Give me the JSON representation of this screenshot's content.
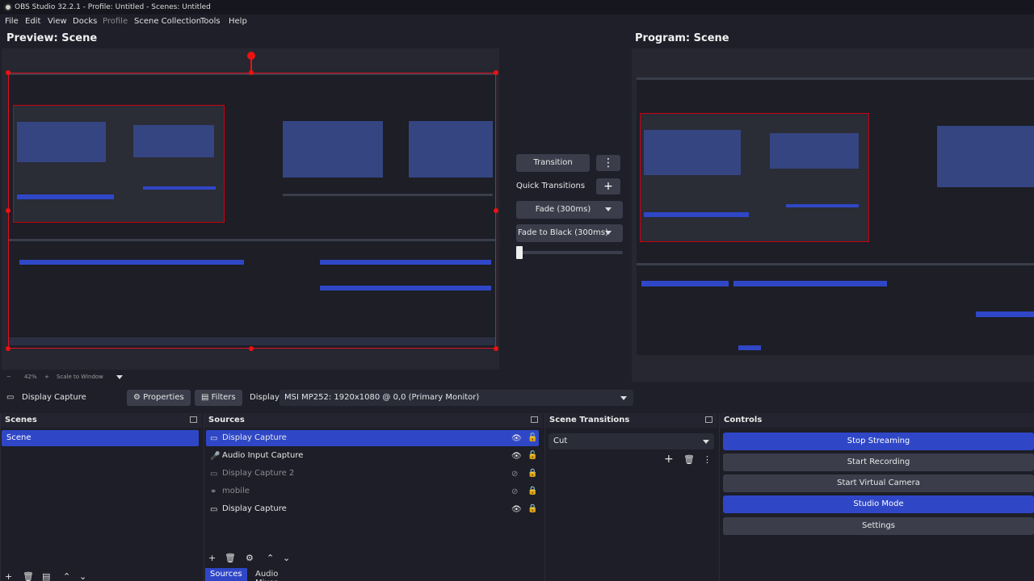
{
  "window": {
    "title": "OBS Studio 32.2.1 - Profile: Untitled - Scenes: Untitled"
  },
  "menu": {
    "items": [
      "File",
      "Edit",
      "View",
      "Docks",
      "Profile",
      "Scene Collection",
      "Tools",
      "Help"
    ]
  },
  "preview": {
    "title": "Preview: Scene"
  },
  "program": {
    "title": "Program: Scene"
  },
  "zoom": {
    "level": "42%",
    "scale_label": "Scale to Window"
  },
  "transitions_panel": {
    "transition_label": "Transition",
    "quick_transitions_label": "Quick Transitions",
    "quick": [
      "Fade (300ms)",
      "Fade to Black (300ms)"
    ]
  },
  "context_bar": {
    "source_name": "Display Capture",
    "properties_label": "Properties",
    "filters_label": "Filters",
    "display_label": "Display",
    "display_value": "MSI MP252: 1920x1080 @ 0,0 (Primary Monitor)"
  },
  "docks": {
    "scenes": {
      "title": "Scenes",
      "items": [
        "Scene"
      ]
    },
    "sources": {
      "title": "Sources",
      "items": [
        {
          "name": "Display Capture",
          "icon": "monitor-icon",
          "visible": true,
          "locked": false
        },
        {
          "name": "Audio Input Capture",
          "icon": "microphone-icon",
          "visible": true,
          "locked": false
        },
        {
          "name": "Display Capture 2",
          "icon": "monitor-icon",
          "visible": false,
          "locked": true
        },
        {
          "name": "mobile",
          "icon": "link-icon",
          "visible": false,
          "locked": true
        },
        {
          "name": "Display Capture",
          "icon": "monitor-icon",
          "visible": true,
          "locked": true
        }
      ],
      "tabs": [
        "Sources",
        "Audio Mixer"
      ]
    },
    "scene_transitions": {
      "title": "Scene Transitions",
      "selected": "Cut"
    },
    "controls": {
      "title": "Controls",
      "buttons": [
        "Stop Streaming",
        "Start Recording",
        "Start Virtual Camera",
        "Studio Mode",
        "Settings"
      ]
    }
  },
  "colors": {
    "accent": "#2f47c7",
    "selection_border": "#e11111",
    "background": "#1e1f29"
  }
}
